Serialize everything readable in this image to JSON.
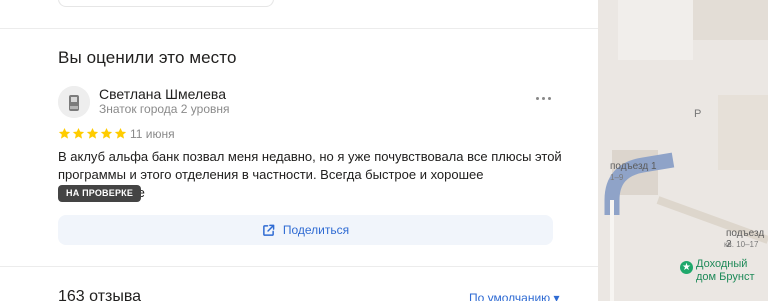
{
  "section": {
    "title": "Вы оценили это место"
  },
  "review": {
    "author": "Светлана Шмелева",
    "level": "Знаток города 2 уровня",
    "rating": 5,
    "date": "11 июня",
    "text": "В аклуб альфа банк позвал меня недавно, но я уже почувствовала все плюсы этой программы и этого отделения в частности. Всегда быстрое и хорошее обслуживание",
    "badge": "НА ПРОВЕРКЕ",
    "share_label": "Поделиться"
  },
  "reviews": {
    "count_label": "163 отзыва",
    "sort_label": "По умолчанию"
  },
  "map": {
    "parking_label": "P",
    "entrance1": "подъезд 1",
    "entrance1_flats": "1–9",
    "entrance2": "подъезд 2",
    "entrance2_flats": "кв. 10–17",
    "poi_line1": "Доходный",
    "poi_line2": "дом Брунст"
  },
  "colors": {
    "accent": "#2f6bd3",
    "star": "#fc0",
    "badge_bg": "#444444",
    "poi": "#1fa86b"
  }
}
